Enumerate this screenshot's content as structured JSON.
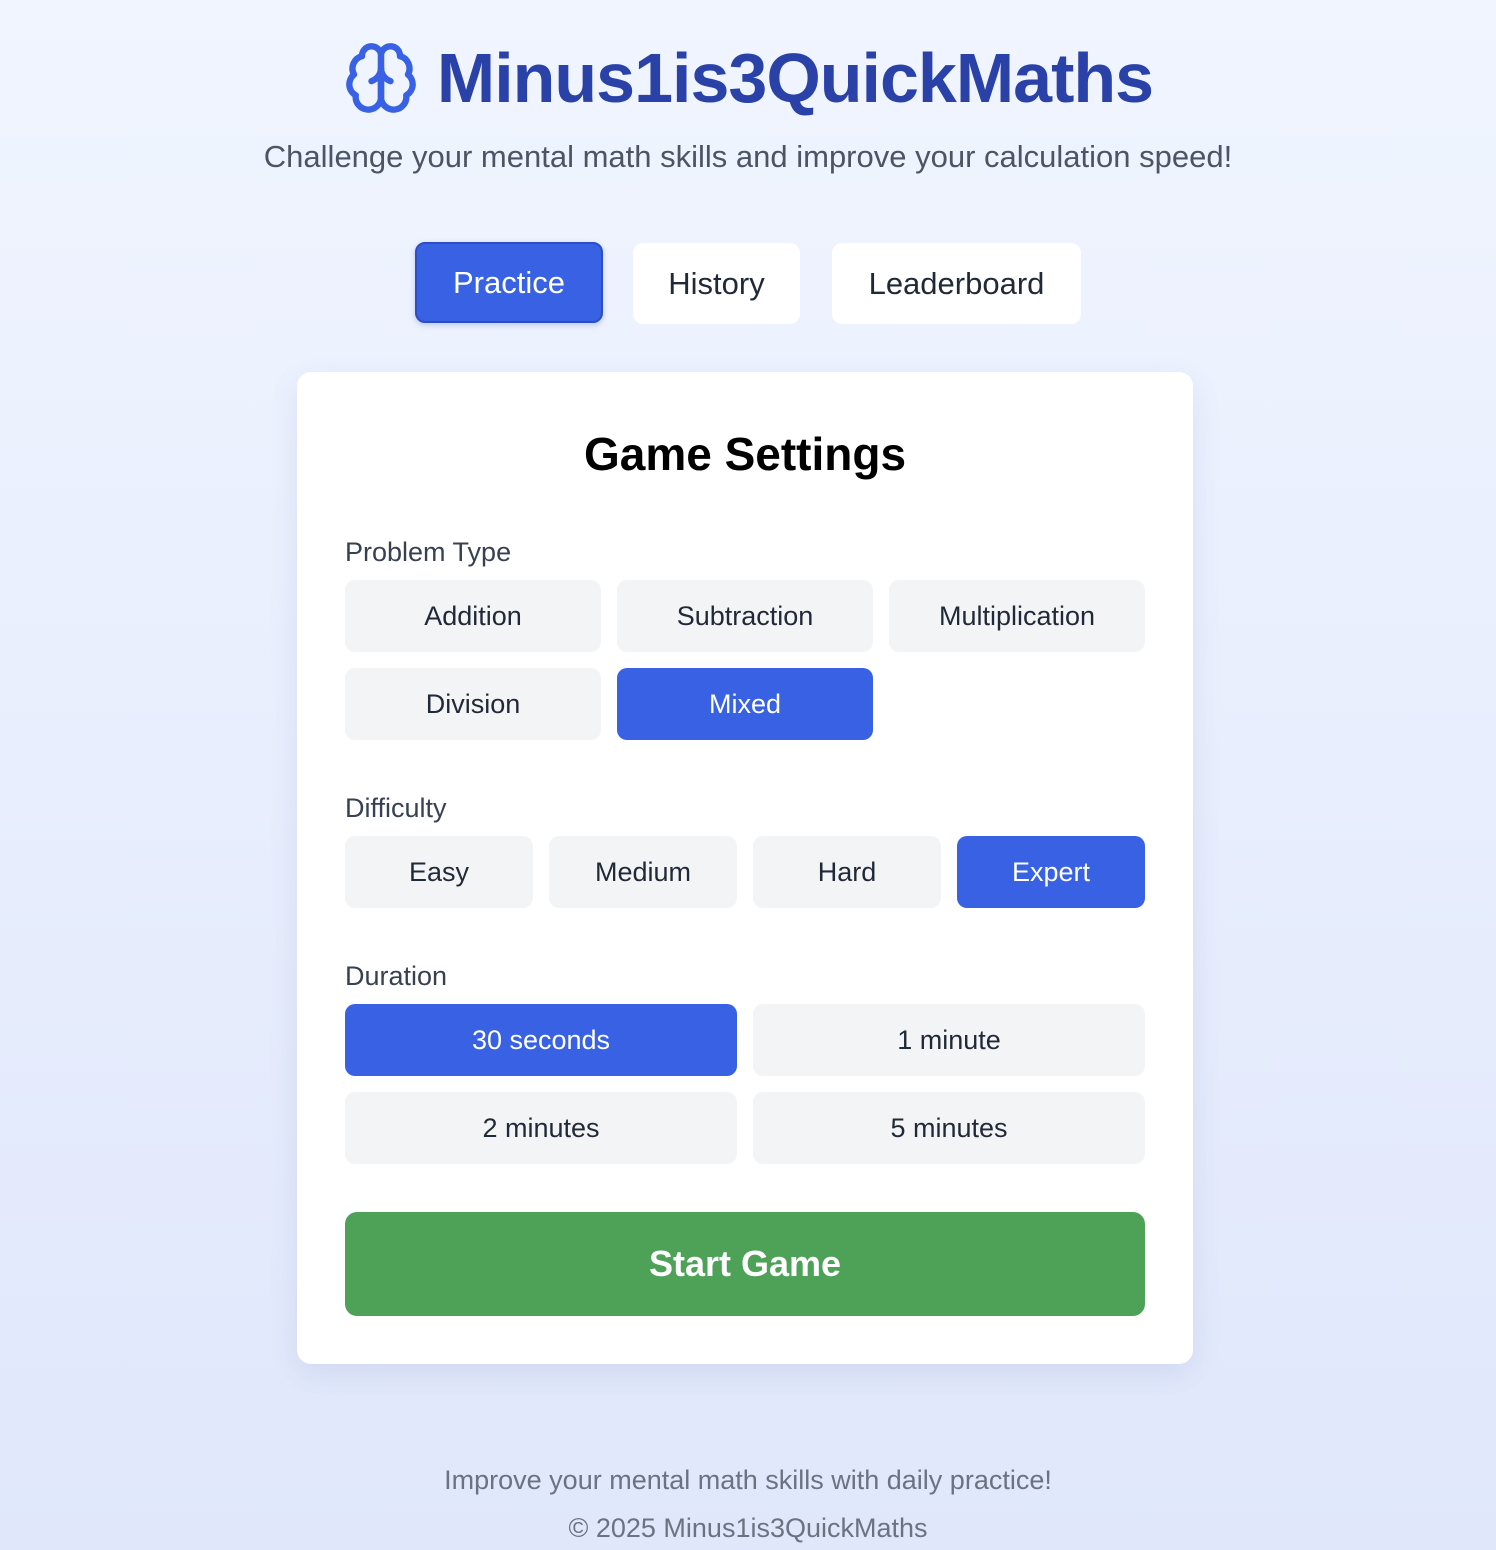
{
  "header": {
    "icon": "brain-icon",
    "title": "Minus1is3QuickMaths",
    "subtitle": "Challenge your mental math skills and improve your calculation speed!"
  },
  "nav": {
    "tabs": [
      {
        "label": "Practice",
        "active": true
      },
      {
        "label": "History",
        "active": false
      },
      {
        "label": "Leaderboard",
        "active": false
      }
    ]
  },
  "settings": {
    "title": "Game Settings",
    "problem_type": {
      "label": "Problem Type",
      "options": [
        "Addition",
        "Subtraction",
        "Multiplication",
        "Division",
        "Mixed"
      ],
      "selected": "Mixed"
    },
    "difficulty": {
      "label": "Difficulty",
      "options": [
        "Easy",
        "Medium",
        "Hard",
        "Expert"
      ],
      "selected": "Expert"
    },
    "duration": {
      "label": "Duration",
      "options": [
        "30 seconds",
        "1 minute",
        "2 minutes",
        "5 minutes"
      ],
      "selected": "30 seconds"
    },
    "start_label": "Start Game"
  },
  "footer": {
    "tagline": "Improve your mental math skills with daily practice!",
    "copyright": "© 2025 Minus1is3QuickMaths"
  },
  "colors": {
    "primary": "#3861e3",
    "brand": "#2a41a8",
    "start": "#4ea257",
    "option_bg": "#f3f4f6"
  }
}
